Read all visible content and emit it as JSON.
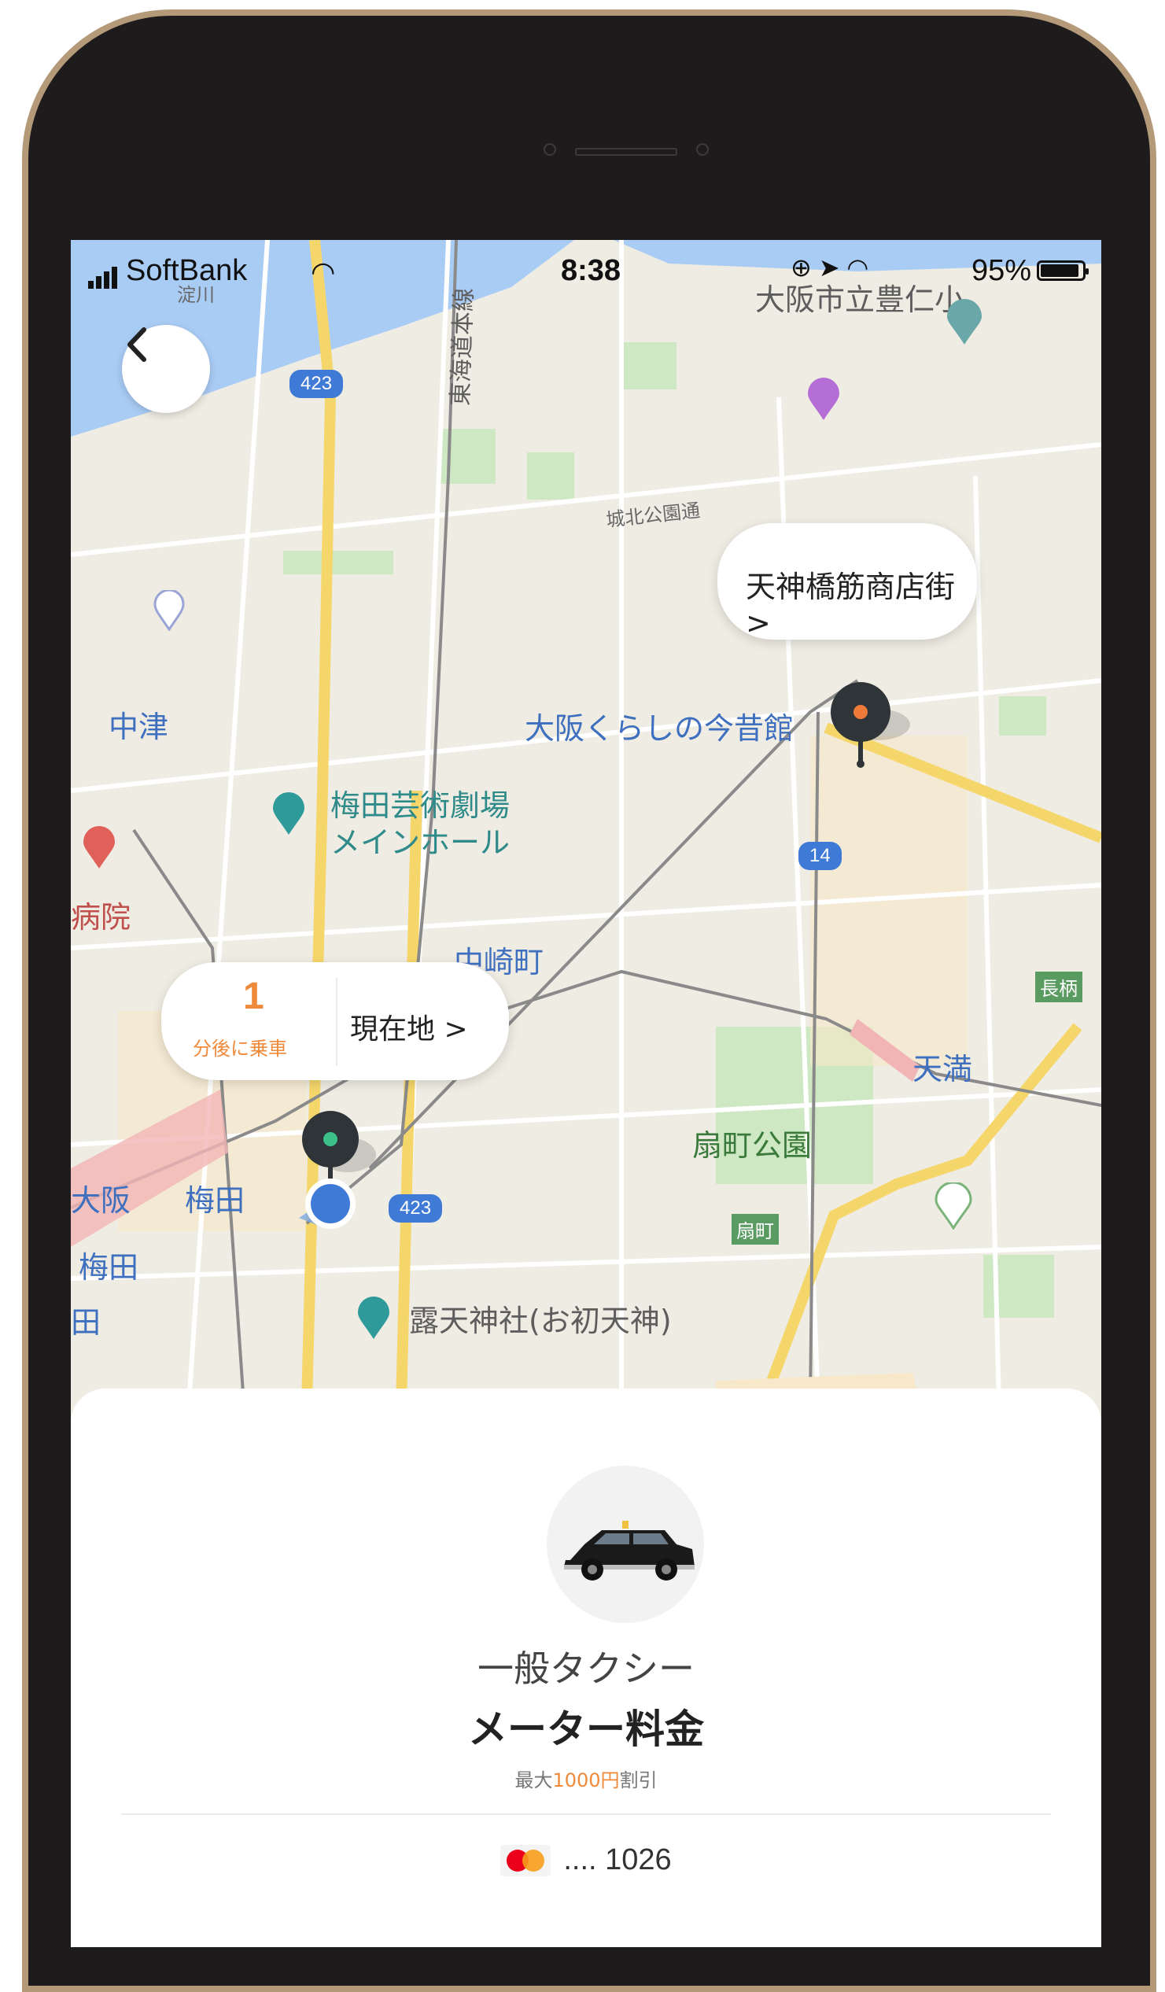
{
  "status_bar": {
    "carrier": "SoftBank",
    "time": "8:38",
    "battery_percent": "95%"
  },
  "map": {
    "labels": {
      "yodogawa": "淀川",
      "school": "大阪市立豊仁小",
      "tokaido_line": "東海道本線",
      "joho_koen_dori": "城北公園通",
      "nakatsu": "中津",
      "osaka_kurashi": "大阪くらしの今昔館",
      "umeda_geijutsu_1": "梅田芸術劇場",
      "umeda_geijutsu_2": "メインホール",
      "hospital": "病院",
      "nakazakicho": "中崎町",
      "nagara": "長柄",
      "tenma": "天満",
      "ogimachi_koen": "扇町公園",
      "ogimachi": "扇町",
      "osaka": "大阪",
      "umeda": "梅田",
      "umeda2": "梅田",
      "ta": "田",
      "tsuyunoten": "露天神社(お初天神)"
    },
    "route_badges": {
      "r423_top": "423",
      "r14": "14",
      "r423_bottom": "423"
    }
  },
  "destination": {
    "label": "天神橋筋商店街 >"
  },
  "pickup": {
    "eta_minutes": "1",
    "eta_unit": "分後に乗車",
    "location_label": "現在地 >"
  },
  "ride": {
    "car_type": "一般タクシー",
    "fare_type": "メーター料金",
    "discount_prefix": "最大",
    "discount_amount": "1000円",
    "discount_suffix": "割引"
  },
  "payment": {
    "card_icon": "mastercard-icon",
    "card_number": ".... 1026"
  },
  "colors": {
    "accent_orange": "#f08a3b",
    "pin_dark": "#2f3438",
    "pickup_dot": "#3dbf8a",
    "dest_dot": "#f07a3a",
    "location_blue": "#3f7ad6"
  }
}
